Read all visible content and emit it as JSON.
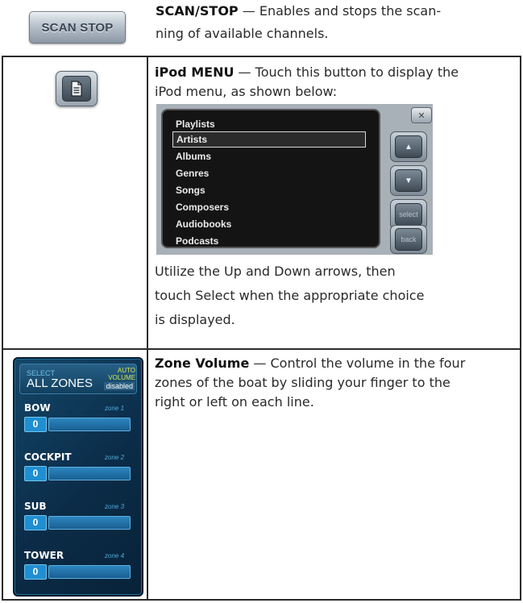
{
  "row_scan": {
    "button_label": "SCAN STOP",
    "title": "SCAN/STOP",
    "dash": " — ",
    "line1": "Enables and stops the scan-",
    "line2": "ning of available channels."
  },
  "row_ipod": {
    "button_icon": "document-icon",
    "title": "iPod MENU",
    "dash": " — ",
    "intro_line1": "Touch this button to display the",
    "intro_line2": "iPod menu, as shown below:",
    "menu_items": [
      "Playlists",
      "Artists",
      "Albums",
      "Genres",
      "Songs",
      "Composers",
      "Audiobooks",
      "Podcasts"
    ],
    "selected_item": "Artists",
    "close_glyph": "✕",
    "side_buttons": [
      "▲",
      "▼",
      "select",
      "back"
    ],
    "after_line1": "Utilize the Up and Down arrows, then",
    "after_line2": "touch Select when the appropriate choice",
    "after_line3": "is displayed."
  },
  "row_zone": {
    "title": "Zone Volume",
    "dash": " — ",
    "line1": "Control the volume in the four",
    "line2": "zones of the boat by sliding your finger to the",
    "line3": "right or left on each line.",
    "panel": {
      "select_small": "SELECT",
      "select_big": "ALL ZONES",
      "auto": "AUTO",
      "volume": "VOLUME",
      "disabled": "disabled",
      "zones": [
        {
          "name": "BOW",
          "tag": "zone 1",
          "value": "0"
        },
        {
          "name": "COCKPIT",
          "tag": "zone 2",
          "value": "0"
        },
        {
          "name": "SUB",
          "tag": "zone 3",
          "value": "0"
        },
        {
          "name": "TOWER",
          "tag": "zone 4",
          "value": "0"
        }
      ]
    }
  }
}
